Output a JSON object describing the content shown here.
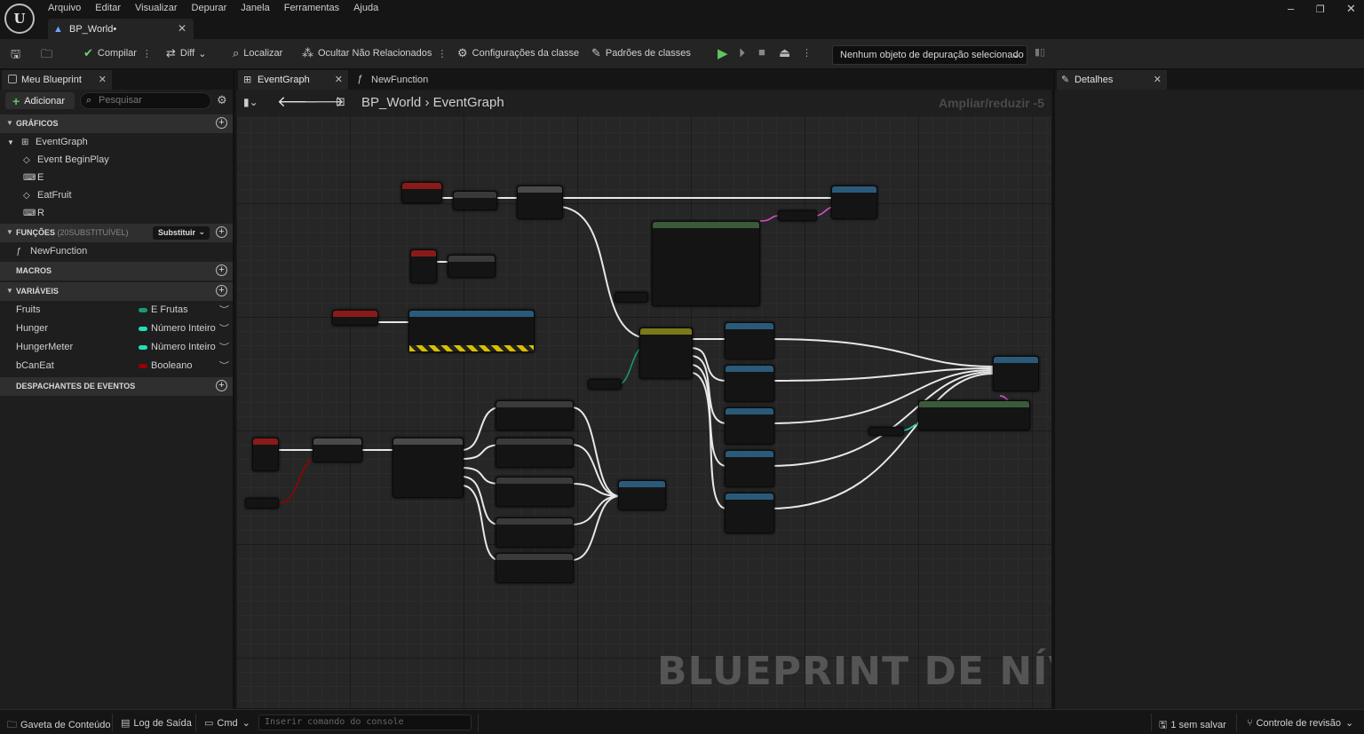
{
  "window": {
    "logo": "U",
    "menu": [
      "Arquivo",
      "Editar",
      "Visualizar",
      "Depurar",
      "Janela",
      "Ferramentas",
      "Ajuda"
    ],
    "document_tab": "BP_World•",
    "controls": {
      "minimize": "–",
      "maximize": "❐",
      "close": "✕"
    }
  },
  "toolbar": {
    "compile": "Compilar",
    "diff": "Diff",
    "locate": "Localizar",
    "hide_unrelated": "Ocultar Não Relacionados",
    "class_settings": "Configurações da classe",
    "class_defaults": "Padrões de classes",
    "debug_object": "Nenhum objeto de depuração selecionado"
  },
  "left_panel": {
    "tab": "Meu Blueprint",
    "add_button": "Adicionar",
    "search_placeholder": "Pesquisar",
    "graphs_title": "GRÁFICOS",
    "graphs": [
      "EventGraph",
      "Event BeginPlay",
      "E",
      "EatFruit",
      "R"
    ],
    "functions_title": "FUNÇÕES",
    "functions_sub": "(20SUBSTITUÍVEL)",
    "override_button": "Substituir",
    "functions": [
      "NewFunction"
    ],
    "macros_title": "MACROS",
    "variables_title": "VARIÁVEIS",
    "variables": [
      {
        "name": "Fruits",
        "type": "E Frutas",
        "color": "#1a9a7a"
      },
      {
        "name": "Hunger",
        "type": "Número Inteiro",
        "color": "#1fe0b8"
      },
      {
        "name": "HungerMeter",
        "type": "Número Inteiro",
        "color": "#1fe0b8"
      },
      {
        "name": "bCanEat",
        "type": "Booleano",
        "color": "#9a0000"
      }
    ],
    "dispatchers_title": "DESPACHANTES DE EVENTOS"
  },
  "graph": {
    "tabs": [
      "EventGraph",
      "NewFunction"
    ],
    "breadcrumb_root": "BP_World",
    "breadcrumb_sep": "›",
    "breadcrumb_current": "EventGraph",
    "zoom": "Ampliar/reduzir -5",
    "watermark": "BLUEPRINT DE NÍVEL"
  },
  "right_panel": {
    "tab": "Detalhes"
  },
  "status": {
    "content_drawer": "Gaveta de Conteúdo",
    "output_log": "Log de Saída",
    "cmd": "Cmd",
    "console_placeholder": "Inserir comando do console",
    "unsaved": "1 sem salvar",
    "source_control": "Controle de revisão"
  }
}
